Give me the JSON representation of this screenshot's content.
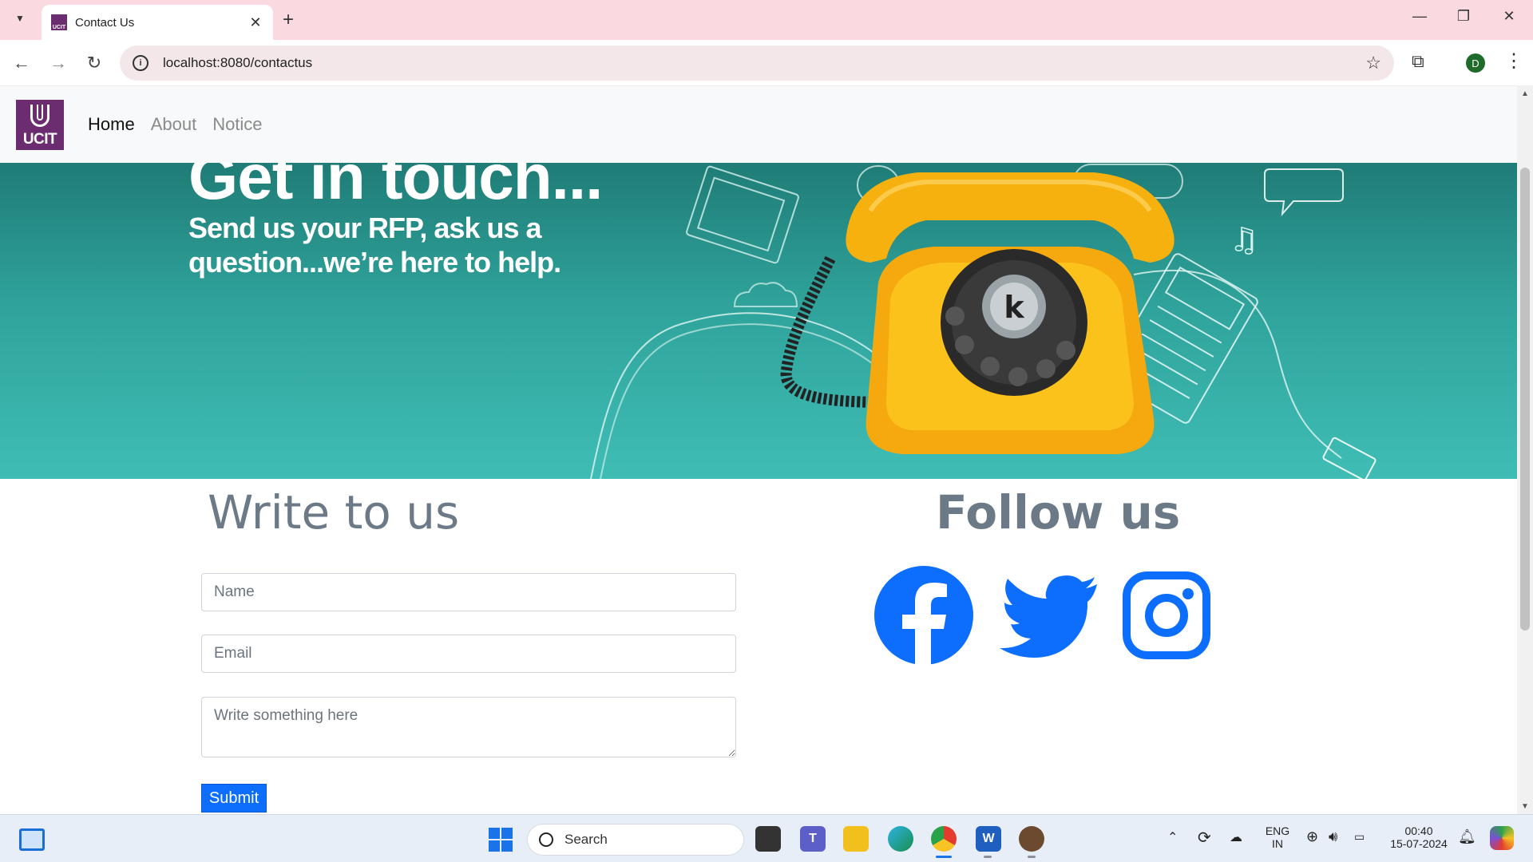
{
  "browser": {
    "tab_title": "Contact Us",
    "url": "localhost:8080/contactus",
    "profile_initial": "D",
    "favicon_text": "UCIT"
  },
  "site": {
    "brand": "UCIT",
    "nav": [
      {
        "label": "Home",
        "active": true
      },
      {
        "label": "About",
        "active": false
      },
      {
        "label": "Notice",
        "active": false
      }
    ]
  },
  "hero": {
    "title": "Get in touch...",
    "subtitle": "Send us your RFP, ask us a question...we’re here to help.",
    "phone_badge": "k"
  },
  "contact": {
    "write_title": "Write to us",
    "follow_title": "Follow us",
    "name_placeholder": "Name",
    "email_placeholder": "Email",
    "message_placeholder": "Write something here",
    "submit_label": "Submit",
    "social": [
      {
        "name": "facebook-icon",
        "color": "#0d6efd"
      },
      {
        "name": "twitter-icon",
        "color": "#0d6efd"
      },
      {
        "name": "instagram-icon",
        "color": "#0d6efd"
      }
    ]
  },
  "taskbar": {
    "search_label": "Search",
    "lang_line1": "ENG",
    "lang_line2": "IN",
    "time": "00:40",
    "date": "15-07-2024"
  },
  "colors": {
    "brand_purple": "#6b2d6f",
    "hero_teal": "#2fa39b",
    "accent_blue": "#0d6efd",
    "heading_gray": "#6c7a87"
  }
}
